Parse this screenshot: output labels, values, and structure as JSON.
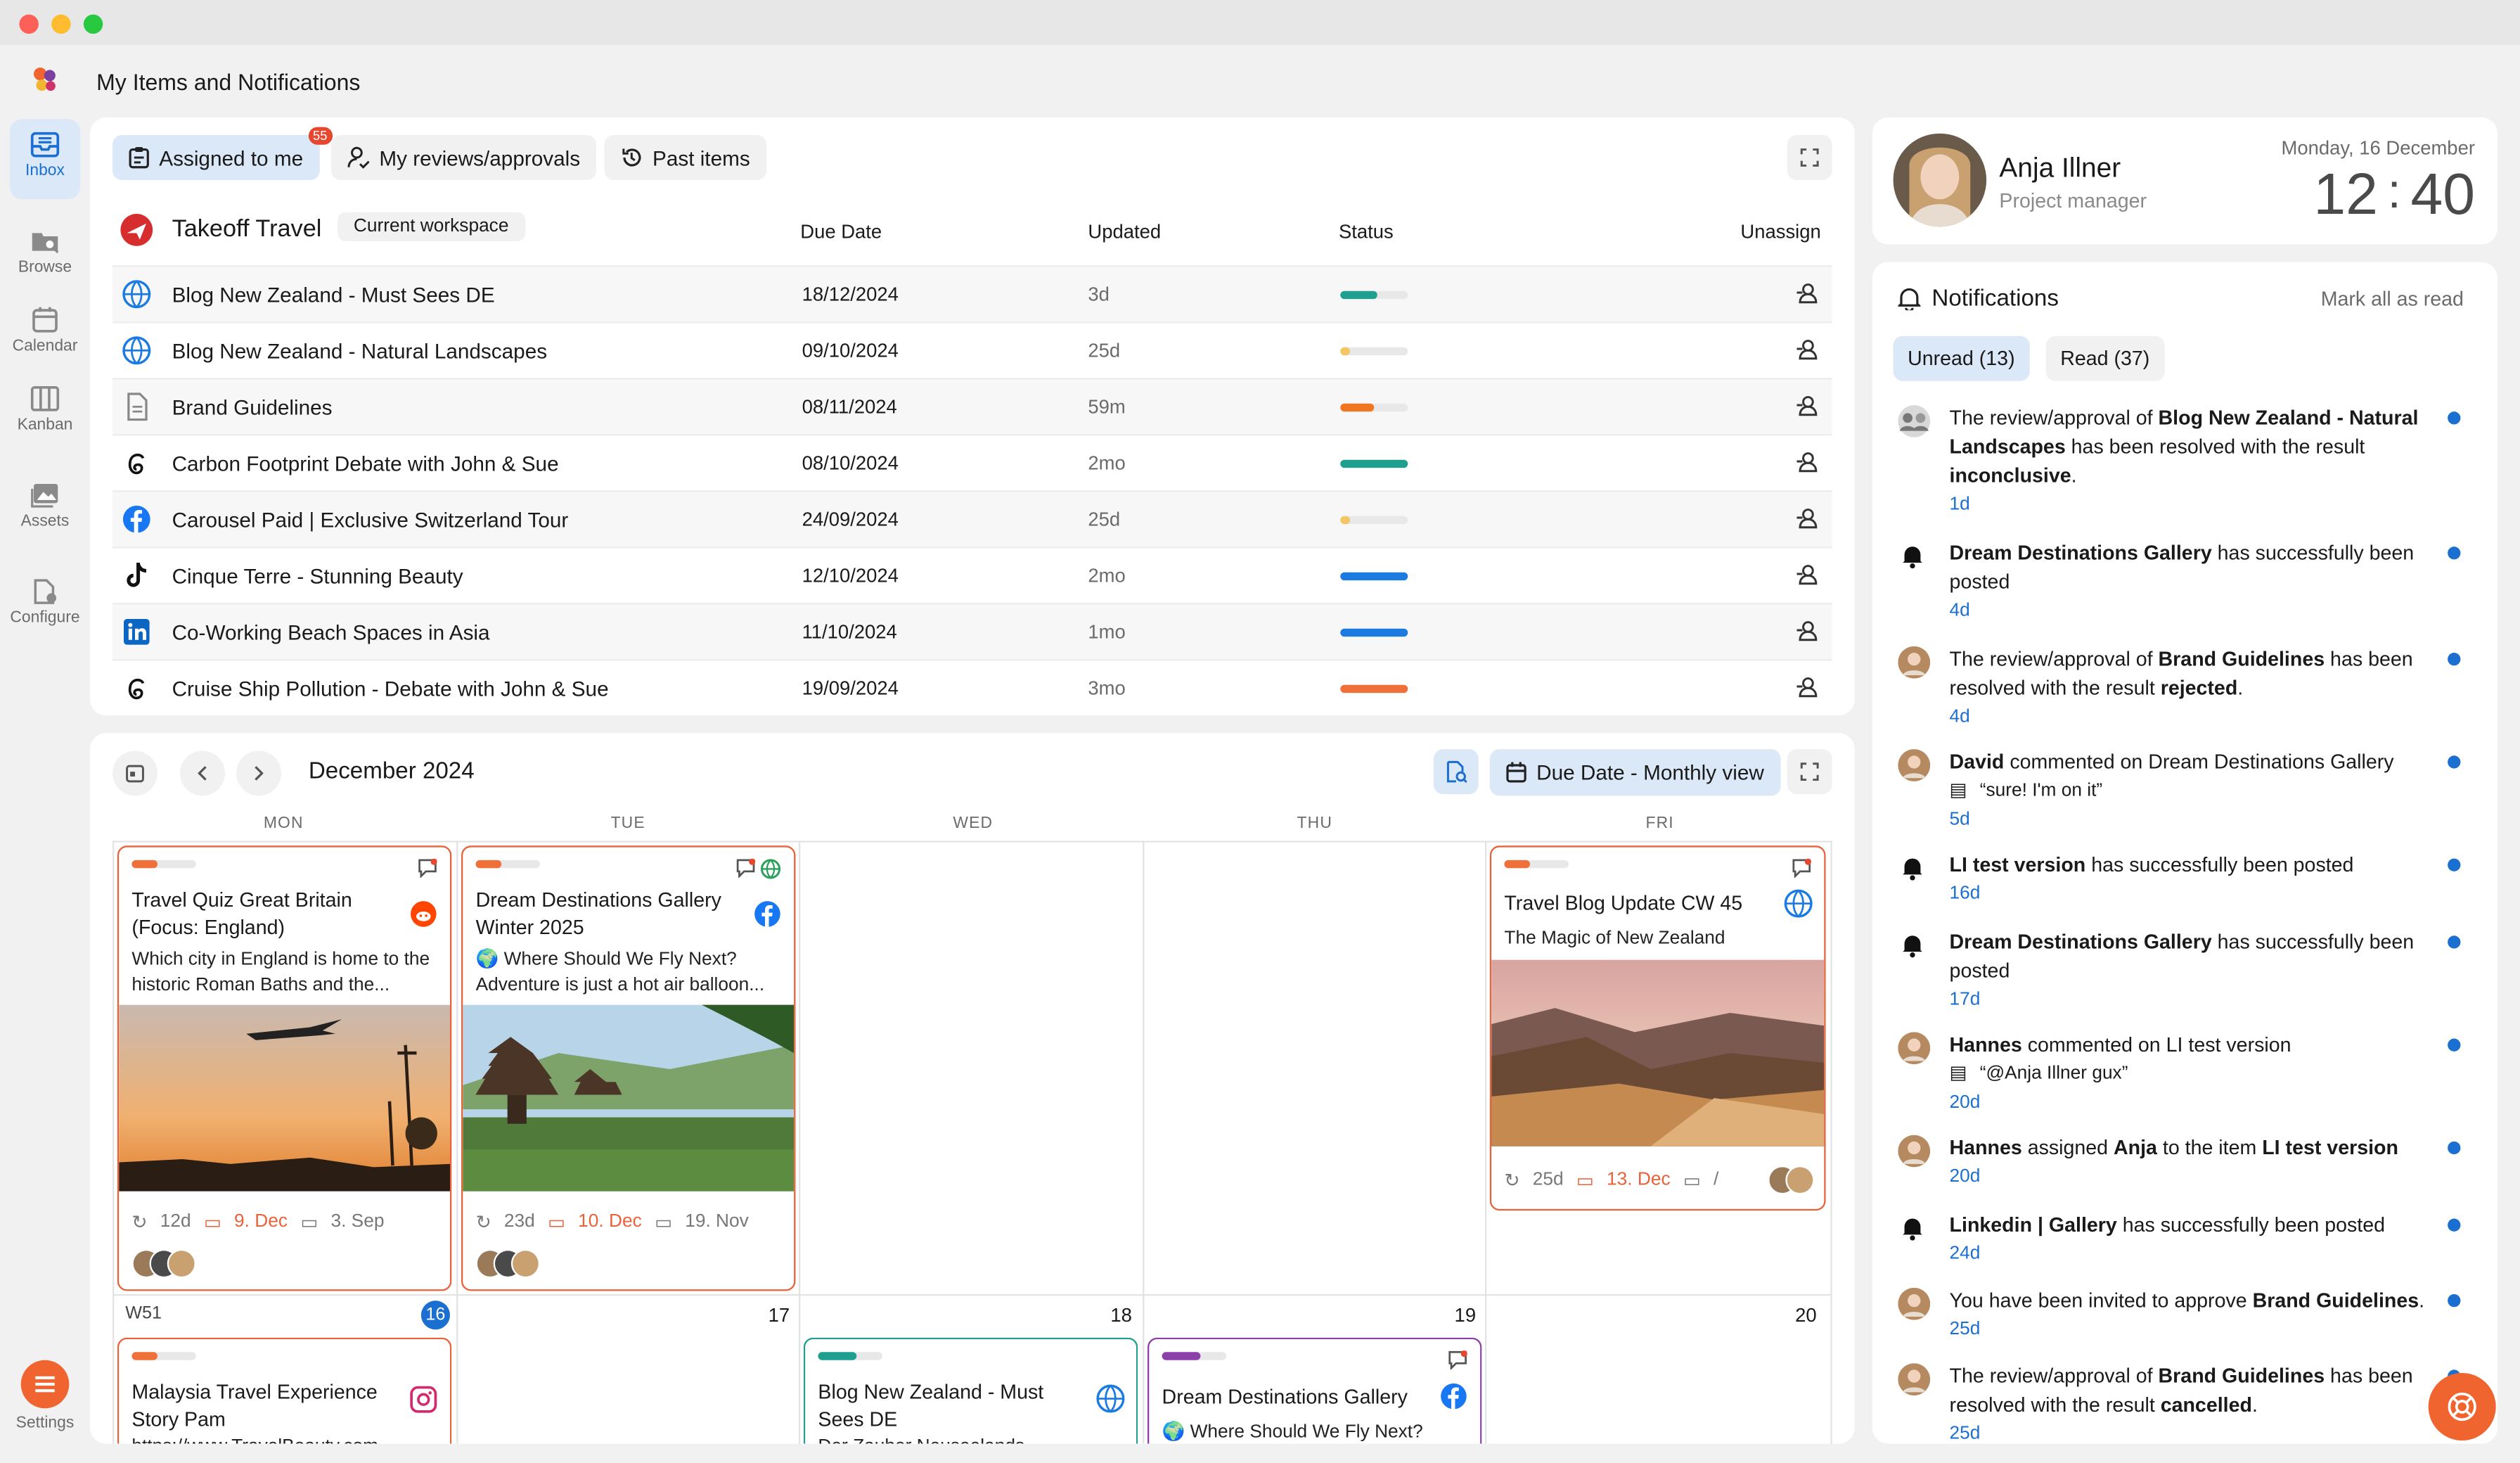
{
  "window": {
    "title": "My Items and Notifications"
  },
  "sidebar": {
    "items": [
      {
        "label": "Inbox",
        "icon": "inbox-icon"
      },
      {
        "label": "Browse",
        "icon": "browse-icon"
      },
      {
        "label": "Calendar",
        "icon": "calendar-icon"
      },
      {
        "label": "Kanban",
        "icon": "kanban-icon"
      },
      {
        "label": "Assets",
        "icon": "assets-icon"
      },
      {
        "label": "Configure",
        "icon": "configure-icon"
      }
    ],
    "settings_label": "Settings"
  },
  "items_panel": {
    "tabs": [
      {
        "label": "Assigned to me",
        "badge": "55"
      },
      {
        "label": "My reviews/approvals"
      },
      {
        "label": "Past items"
      }
    ],
    "workspace": "Takeoff Travel",
    "workspace_badge": "Current workspace",
    "columns": {
      "due": "Due Date",
      "updated": "Updated",
      "status": "Status",
      "unassign": "Unassign"
    },
    "rows": [
      {
        "name": "Blog New Zealand - Must Sees DE",
        "due": "18/12/2024",
        "updated": "3d",
        "icon": "globe-icon",
        "status_pct": 55,
        "status_color": "#1fa08e"
      },
      {
        "name": "Blog New Zealand - Natural Landscapes",
        "due": "09/10/2024",
        "updated": "25d",
        "icon": "globe-icon",
        "status_pct": 15,
        "status_color": "#f3c565"
      },
      {
        "name": "Brand Guidelines",
        "due": "08/11/2024",
        "updated": "59m",
        "icon": "document-icon",
        "status_pct": 50,
        "status_color": "#f0771f"
      },
      {
        "name": "Carbon Footprint Debate with John & Sue",
        "due": "08/10/2024",
        "updated": "2mo",
        "icon": "threads-icon",
        "status_pct": 100,
        "status_color": "#1fa08e"
      },
      {
        "name": "Carousel Paid | Exclusive Switzerland Tour",
        "due": "24/09/2024",
        "updated": "25d",
        "icon": "facebook-icon",
        "status_pct": 15,
        "status_color": "#f3c565"
      },
      {
        "name": "Cinque Terre - Stunning Beauty",
        "due": "12/10/2024",
        "updated": "2mo",
        "icon": "tiktok-icon",
        "status_pct": 100,
        "status_color": "#1b7be0"
      },
      {
        "name": "Co-Working Beach Spaces in Asia",
        "due": "11/10/2024",
        "updated": "1mo",
        "icon": "linkedin-icon",
        "status_pct": 100,
        "status_color": "#1b7be0"
      },
      {
        "name": "Cruise Ship Pollution - Debate with John & Sue",
        "due": "19/09/2024",
        "updated": "3mo",
        "icon": "threads-icon",
        "status_pct": 100,
        "status_color": "#f0703a"
      }
    ]
  },
  "calendar": {
    "month": "December 2024",
    "view_label": "Due Date - Monthly view",
    "days": [
      "MON",
      "TUE",
      "WED",
      "THU",
      "FRI"
    ],
    "week2": {
      "label": "W51",
      "mon": "16",
      "tue": "17",
      "wed": "18",
      "thu": "19",
      "fri": "20"
    },
    "cards": [
      {
        "title": "Travel Quiz Great Britain (Focus: England)",
        "sub": "Which city in England is home to the historic Roman Baths and the...",
        "age": "12d",
        "due": "9. Dec",
        "pub": "3. Sep",
        "network": "reddit-icon"
      },
      {
        "title": "Dream Destinations Gallery Winter 2025",
        "sub": "🌍 Where Should We Fly Next? Adventure is just a hot air balloon...",
        "age": "23d",
        "due": "10. Dec",
        "pub": "19. Nov",
        "network": "facebook-icon"
      },
      {
        "title": "Travel Blog Update CW 45",
        "sub": "The Magic of New Zealand",
        "age": "25d",
        "due": "13. Dec",
        "pub": "/",
        "network": "globe-icon"
      },
      {
        "title": "Malaysia Travel Experience Story Pam",
        "sub": "https://www.TravelBeauty.com",
        "network": "instagram-icon"
      },
      {
        "title": "Blog New Zealand - Must Sees DE",
        "sub": "Der Zauber Neuseelands",
        "network": "globe-icon"
      },
      {
        "title": "Dream Destinations Gallery",
        "sub": "🌍 Where Should We Fly Next?",
        "network": "facebook-icon"
      }
    ]
  },
  "profile": {
    "name": "Anja Illner",
    "role": "Project manager",
    "date": "Monday, 16 December",
    "hours": "12",
    "minutes": "40"
  },
  "notifications": {
    "title": "Notifications",
    "mark_all": "Mark all as read",
    "tab_unread": "Unread (13)",
    "tab_read": "Read (37)",
    "items": [
      {
        "pre": "The review/approval of ",
        "b1": "Blog New Zealand - Natural Landscapes",
        "mid": " has been resolved with the result ",
        "b2": "inconclusive",
        "post": ".",
        "time": "1d"
      },
      {
        "pre": "",
        "b1": "Dream Destinations Gallery",
        "mid": " has successfully been posted",
        "b2": "",
        "post": "",
        "time": "4d"
      },
      {
        "pre": "The review/approval of ",
        "b1": "Brand Guidelines",
        "mid": " has been resolved with the result ",
        "b2": "rejected",
        "post": ".",
        "time": "4d"
      },
      {
        "pre": "",
        "b1": "David",
        "mid": " commented on Dream Destinations Gallery",
        "b2": "",
        "post": "",
        "quote": "“sure! I'm on it”",
        "time": "5d"
      },
      {
        "pre": "",
        "b1": "LI test version",
        "mid": " has successfully been posted",
        "b2": "",
        "post": "",
        "time": "16d"
      },
      {
        "pre": "",
        "b1": "Dream Destinations Gallery",
        "mid": " has successfully been posted",
        "b2": "",
        "post": "",
        "time": "17d"
      },
      {
        "pre": "",
        "b1": "Hannes",
        "mid": " commented on LI test version",
        "b2": "",
        "post": "",
        "quote": "“@Anja Illner gux”",
        "time": "20d"
      },
      {
        "pre": "",
        "b1": "Hannes",
        "mid": " assigned ",
        "b2": "Anja",
        "post": " to the item ",
        "b3": "LI test version",
        "time": "20d"
      },
      {
        "pre": "",
        "b1": "Linkedin | Gallery",
        "mid": " has successfully been posted",
        "b2": "",
        "post": "",
        "time": "24d"
      },
      {
        "pre": "You have been invited to approve ",
        "b1": "Brand Guidelines",
        "mid": ".",
        "b2": "",
        "post": "",
        "time": "25d"
      },
      {
        "pre": "The review/approval of ",
        "b1": "Brand Guidelines",
        "mid": " has been resolved with the result ",
        "b2": "cancelled",
        "post": ".",
        "time": "25d"
      }
    ]
  }
}
